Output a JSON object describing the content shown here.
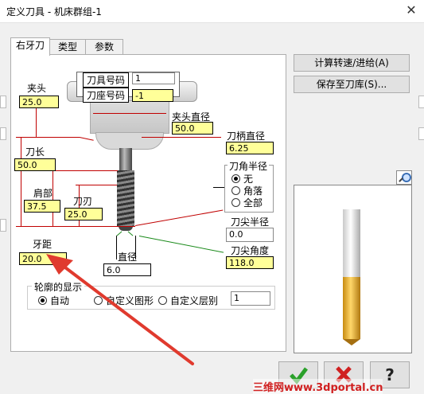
{
  "window": {
    "title": "定义刀具 - 机床群组-1"
  },
  "tabs": [
    "右牙刀",
    "类型",
    "参数"
  ],
  "diagram": {
    "tool_number_label": "刀具号码",
    "tool_number_value": "1",
    "tool_seat_label": "刀座号码",
    "tool_seat_value": "-1",
    "holder_label": "夹头",
    "holder_value": "25.0",
    "holder_dia_label": "夹头直径",
    "holder_dia_value": "50.0",
    "shank_dia_label": "刀柄直径",
    "shank_dia_value": "6.25",
    "tool_length_label": "刀长",
    "tool_length_value": "50.0",
    "shoulder_label": "肩部",
    "shoulder_value": "37.5",
    "flute_label": "刀刃",
    "flute_value": "25.0",
    "corner_radius_label": "刀角半径",
    "corner_options": [
      "无",
      "角落",
      "全部"
    ],
    "tip_radius_label": "刀尖半径",
    "tip_radius_value": "0.0",
    "pitch_label": "牙距",
    "pitch_value": "20.0",
    "tip_angle_label": "刀尖角度",
    "tip_angle_value": "118.0",
    "diameter_label": "直径",
    "diameter_value": "6.0"
  },
  "profile": {
    "label": "轮廓的显示",
    "options": [
      "自动",
      "自定义图形",
      "自定义层别"
    ],
    "value": "1"
  },
  "buttons": {
    "calc": "计算转速/进给(A)",
    "save": "保存至刀库(S)..."
  },
  "watermark": "三维网www.3dportal.cn",
  "colors": {
    "input_bg": "#ffff99",
    "dim_red": "#c00000",
    "dim_green": "#1a8a1a",
    "tool_gold": "#d8a020"
  }
}
